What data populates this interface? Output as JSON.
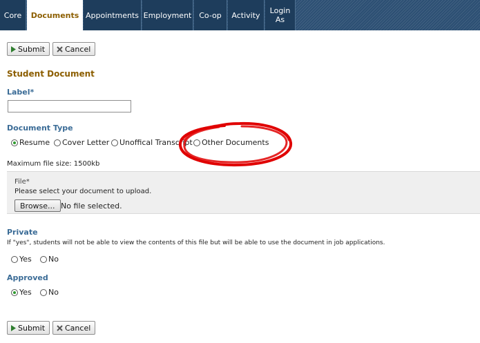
{
  "nav": {
    "tabs": [
      {
        "label": "Core"
      },
      {
        "label": "Documents",
        "active": true
      },
      {
        "label": "Appointments"
      },
      {
        "label": "Employment"
      },
      {
        "label": "Co-op"
      },
      {
        "label": "Activity"
      },
      {
        "label": "Login As"
      }
    ]
  },
  "toolbar": {
    "submit_label": "Submit",
    "cancel_label": "Cancel"
  },
  "form": {
    "section_title": "Student Document",
    "label_field": {
      "label": "Label*",
      "value": ""
    },
    "document_type": {
      "label": "Document Type",
      "options": [
        "Resume",
        "Cover Letter",
        "Unoffical Transcript",
        "Other Documents"
      ],
      "selected": "Resume"
    },
    "max_file_size": "Maximum file size: 1500kb",
    "file": {
      "label": "File*",
      "instruction": "Please select your document to upload.",
      "browse_label": "Browse...",
      "status": "No file selected."
    },
    "private": {
      "label": "Private",
      "help": "If \"yes\", students will not be able to view the contents of this file but will be able to use the document in job applications.",
      "options": [
        "Yes",
        "No"
      ],
      "selected": null
    },
    "approved": {
      "label": "Approved",
      "options": [
        "Yes",
        "No"
      ],
      "selected": "Yes"
    }
  },
  "colors": {
    "nav_bg": "#1e3d5c",
    "active_tab_text": "#8c5e00",
    "label_blue": "#3a6b96",
    "radio_checked": "#2e9a2e",
    "annotation_red": "#e00000"
  }
}
